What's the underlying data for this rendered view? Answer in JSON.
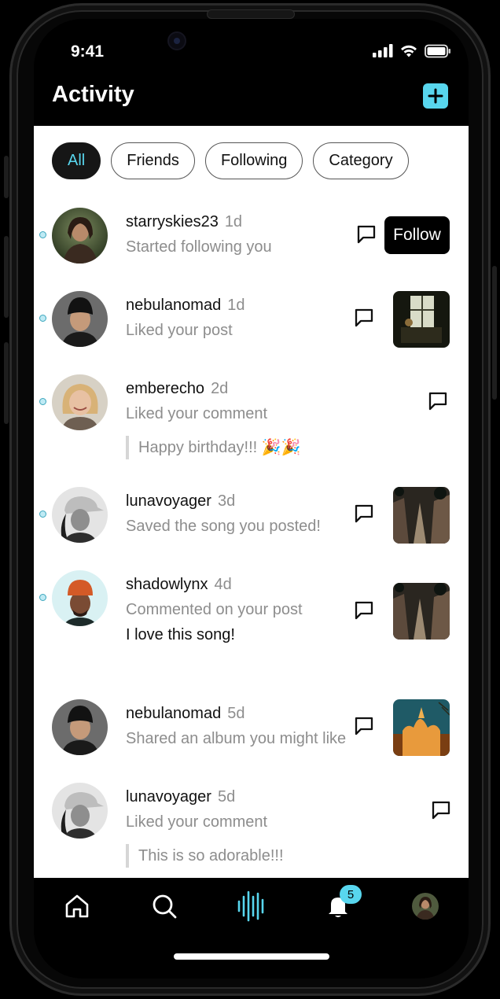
{
  "status": {
    "time": "9:41"
  },
  "header": {
    "title": "Activity",
    "add_icon": "plus-icon"
  },
  "filters": [
    {
      "label": "All",
      "active": true
    },
    {
      "label": "Friends",
      "active": false
    },
    {
      "label": "Following",
      "active": false
    },
    {
      "label": "Category",
      "active": false
    }
  ],
  "activities": [
    {
      "username": "starryskies23",
      "ago": "1d",
      "message": "Started following you",
      "unread": true,
      "action": "Follow"
    },
    {
      "username": "nebulanomad",
      "ago": "1d",
      "message": "Liked your post",
      "unread": true
    },
    {
      "username": "emberecho",
      "ago": "2d",
      "message": "Liked your comment",
      "quote": "Happy birthday!!! 🎉🎉",
      "unread": true
    },
    {
      "username": "lunavoyager",
      "ago": "3d",
      "message": "Saved the song you posted!",
      "unread": true
    },
    {
      "username": "shadowlynx",
      "ago": "4d",
      "message": "Commented on your post",
      "comment": "I love this song!",
      "unread": true
    },
    {
      "username": "nebulanomad",
      "ago": "5d",
      "message": "Shared an album you might like",
      "unread": false
    },
    {
      "username": "lunavoyager",
      "ago": "5d",
      "message": "Liked your comment",
      "quote": "This is so adorable!!!",
      "unread": false
    }
  ],
  "tabbar": {
    "items": [
      "home-icon",
      "search-icon",
      "waveform-icon",
      "bell-icon",
      "profile-avatar"
    ],
    "notification_count": "5"
  },
  "colors": {
    "accent": "#58d6ee",
    "background": "#000000",
    "content": "#ffffff",
    "muted_text": "#8d8d8d"
  }
}
